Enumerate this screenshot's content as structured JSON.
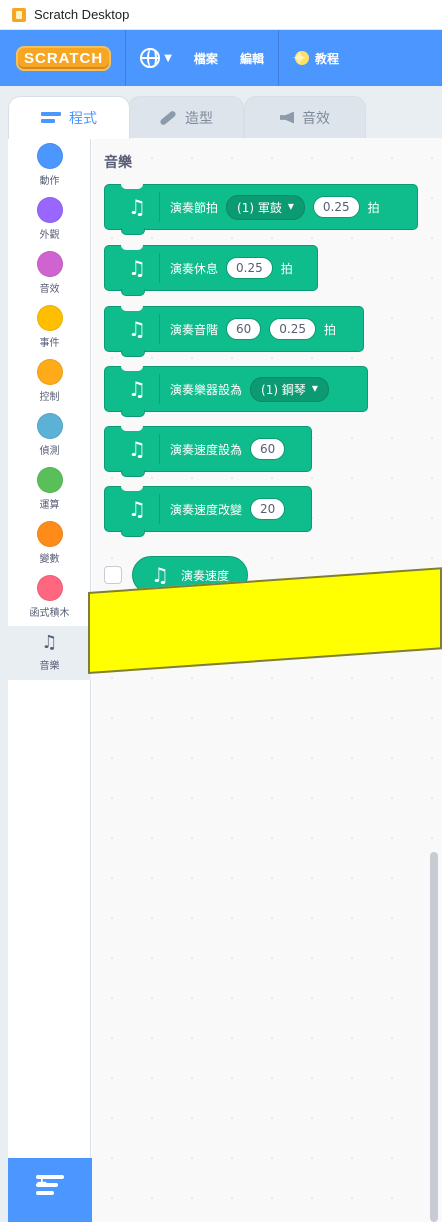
{
  "window": {
    "title": "Scratch Desktop"
  },
  "menubar": {
    "logo_text": "SCRATCH",
    "items": [
      "檔案",
      "編輯"
    ],
    "tutorial_label": "教程"
  },
  "tabs": [
    {
      "label": "程式"
    },
    {
      "label": "造型"
    },
    {
      "label": "音效"
    }
  ],
  "categories": [
    {
      "label": "動作",
      "color": "#4c97ff"
    },
    {
      "label": "外觀",
      "color": "#9966ff"
    },
    {
      "label": "音效",
      "color": "#cf63cf"
    },
    {
      "label": "事件",
      "color": "#ffbf00"
    },
    {
      "label": "控制",
      "color": "#ffab19"
    },
    {
      "label": "偵測",
      "color": "#5cb1d6"
    },
    {
      "label": "運算",
      "color": "#59c059"
    },
    {
      "label": "變數",
      "color": "#ff8c1a"
    },
    {
      "label": "函式積木",
      "color": "#ff6680"
    },
    {
      "label": "音樂",
      "icon": "music-note-icon"
    }
  ],
  "palette": {
    "heading": "音樂",
    "blocks": [
      {
        "text": "演奏節拍",
        "dropdown": "(1) 軍鼓",
        "value": "0.25",
        "suffix": "拍"
      },
      {
        "text": "演奏休息",
        "value": "0.25",
        "suffix": "拍"
      },
      {
        "text": "演奏音階",
        "value1": "60",
        "value2": "0.25",
        "suffix": "拍"
      },
      {
        "text": "演奏樂器設為",
        "dropdown": "(1) 鋼琴"
      },
      {
        "text": "演奏速度設為",
        "value": "60"
      },
      {
        "text": "演奏速度改變",
        "value": "20"
      }
    ],
    "reporter": {
      "text": "演奏速度"
    }
  },
  "colors": {
    "menubar": "#4c97ff",
    "music_block": "#0fbd8c",
    "highlight": "#ffff00"
  }
}
